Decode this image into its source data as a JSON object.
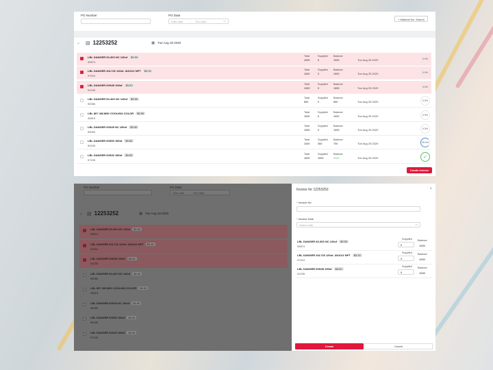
{
  "filters": {
    "po_number_label": "PO Number",
    "po_date_label": "PO Date",
    "start_date_placeholder": "Start date",
    "arrow": "→",
    "end_date_placeholder": "End date",
    "material_search_button": "+ Material No. Search"
  },
  "order": {
    "id": "12253252",
    "date": "Tue Aug 18 2020"
  },
  "qty_labels": {
    "total": "Total",
    "supplied": "Supplied",
    "balance": "Balance"
  },
  "rows": [
    {
      "name": "LBL DANGER 60-300 NC 120of",
      "price": "$5.50",
      "code": "95874",
      "total": "1000",
      "supplied": "0",
      "balance": "1000",
      "date": "Tue Aug 25 2020",
      "progress": "0.0%",
      "selected": true
    },
    {
      "name": "LBL DANGER 40L726 120of -3/4X1/2 NPT",
      "price": "$5.30",
      "code": "97924",
      "total": "1000",
      "supplied": "0",
      "balance": "1000",
      "date": "Tue Aug 25 2020",
      "progress": "0.0%",
      "selected": true
    },
    {
      "name": "LBL DANGER 60H45 190of",
      "price": "$5.50",
      "code": "51035",
      "total": "1000",
      "supplied": "0",
      "balance": "1000",
      "date": "Tue Aug 25 2020",
      "progress": "0.0%",
      "selected": true
    },
    {
      "name": "LBL DANGER 60-400 NC 120of",
      "price": "$5.50",
      "code": "50086",
      "total": "500",
      "supplied": "0",
      "balance": "500",
      "date": "Tue Aug 25 2020",
      "progress": "0.0%",
      "selected": false
    },
    {
      "name": "LBL 807 4W-M30 COOLING-COLOR",
      "price": "$5.50",
      "code": "45615",
      "total": "1000",
      "supplied": "0",
      "balance": "1000",
      "date": "Tue Aug 25 2020",
      "progress": "0.0%",
      "selected": false
    },
    {
      "name": "LBL DANGER 60S45 NC 190of",
      "price": "$5.50",
      "code": "55050",
      "total": "1000",
      "supplied": "0",
      "balance": "1000",
      "date": "Tue Aug 25 2020",
      "progress": "0.0%",
      "selected": false
    },
    {
      "name": "LBL DANGER 60S50 150of",
      "price": "$5.50",
      "code": "56155",
      "total": "1000",
      "supplied": "300",
      "balance": "700",
      "date": "Tue Aug 25 2020",
      "progress": "30.0%",
      "selected": false
    },
    {
      "name": "LBL DANGER 60S30 150of",
      "price": "$5.50",
      "code": "57105",
      "total": "1000",
      "supplied": "1000",
      "balance": "2000",
      "date": "Tue Aug 25 2020",
      "progress": "✓",
      "selected": false
    }
  ],
  "create_invoice_button": "Create invoice",
  "modal": {
    "title": "Invoice for 12253252",
    "close": "×",
    "invoice_no_label": "Invoice No",
    "invoice_date_label": "Invoice Date",
    "required_mark": "*",
    "date_placeholder": "Select date",
    "supplied_label": "Supplied",
    "balance_label": "Balance",
    "items": [
      {
        "name": "LBL DANGER 60-300 NC 120of",
        "price": "$5.50",
        "code": "95874",
        "supplied": "0",
        "balance": "1000"
      },
      {
        "name": "LBL DANGER 40L726 120of -3/4X1/2 NPT",
        "price": "$5.30",
        "code": "97924",
        "supplied": "0",
        "balance": "1000"
      },
      {
        "name": "LBL DANGER 60H45 190of",
        "price": "$5.50",
        "code": "51035",
        "supplied": "0",
        "balance": "1000"
      }
    ],
    "confirm_button": "Create",
    "cancel_button": "Cancel"
  },
  "colors": {
    "accent": "#e0183a",
    "selected_row": "#fde3e6",
    "complete": "#5bbf5b",
    "progress": "#4a8fd8"
  },
  "icons": {
    "calendar": "calendar-icon",
    "caret": "chevron-down-icon",
    "close": "close-icon",
    "check": "check-icon"
  }
}
